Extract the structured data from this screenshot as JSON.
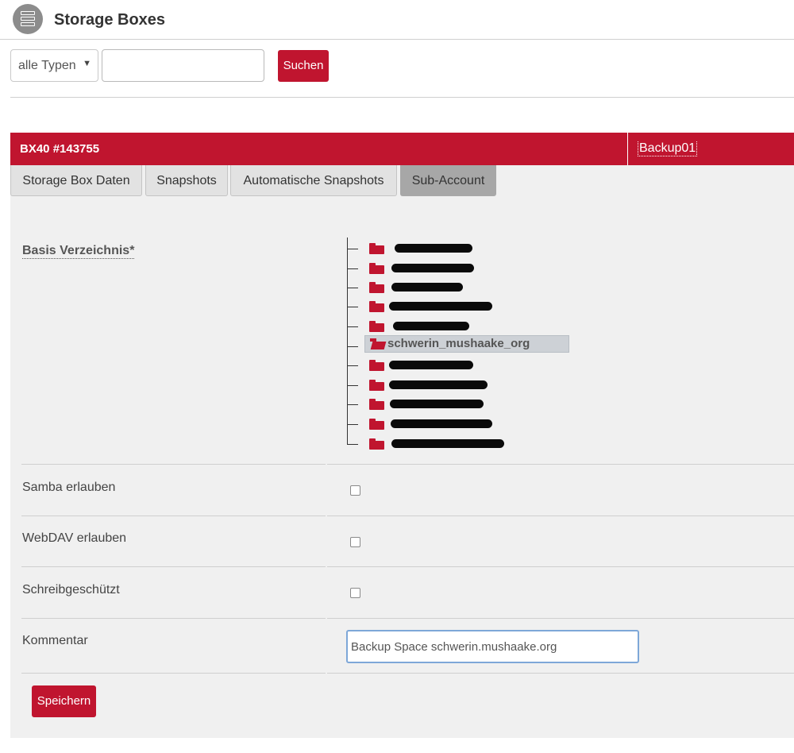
{
  "header": {
    "title": "Storage Boxes",
    "icon": "storage-list-icon"
  },
  "search": {
    "type_select": "alle Typen",
    "input_value": "",
    "button": "Suchen"
  },
  "box": {
    "title": "BX40 #143755",
    "name": "Backup01",
    "tabs": [
      "Storage Box Daten",
      "Snapshots",
      "Automatische Snapshots",
      "Sub-Account"
    ],
    "active_tab": "Sub-Account"
  },
  "form": {
    "basis_label": "Basis Verzeichnis*",
    "selected_folder": "schwerin_mushaake_org",
    "samba_label": "Samba erlauben",
    "samba_checked": false,
    "webdav_label": "WebDAV erlauben",
    "webdav_checked": false,
    "readonly_label": "Schreibgeschützt",
    "readonly_checked": false,
    "comment_label": "Kommentar",
    "comment_value": "Backup Space schwerin.mushaake.org",
    "save_button": "Speichern"
  },
  "colors": {
    "accent": "#c0152f",
    "panel_bg": "#f0f0f0",
    "active_tab": "#a7a7a7"
  }
}
